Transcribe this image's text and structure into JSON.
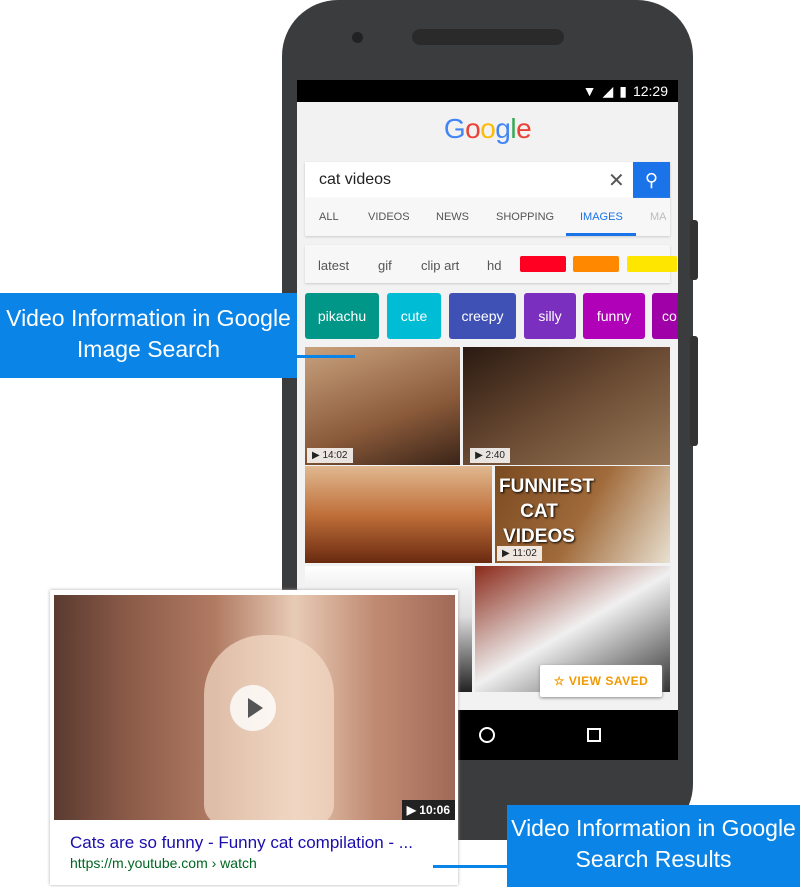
{
  "status_bar": {
    "time": "12:29",
    "icons": [
      "wifi-icon",
      "signal-icon",
      "battery-icon"
    ]
  },
  "logo": "Google",
  "logo_colors": [
    "#4285f4",
    "#ea4335",
    "#fbbc05",
    "#4285f4",
    "#34a853",
    "#ea4335"
  ],
  "search": {
    "query": "cat videos",
    "clear_icon": "close-icon",
    "submit_icon": "search-icon"
  },
  "tabs": [
    {
      "label": "ALL"
    },
    {
      "label": "VIDEOS"
    },
    {
      "label": "NEWS"
    },
    {
      "label": "SHOPPING"
    },
    {
      "label": "IMAGES",
      "active": true
    },
    {
      "label": "MA"
    }
  ],
  "filters": [
    "latest",
    "gif",
    "clip art",
    "hd"
  ],
  "color_filters": [
    "#ff0022",
    "#ff8800",
    "#ffe600"
  ],
  "chips": [
    {
      "label": "pikachu",
      "color": "#009688"
    },
    {
      "label": "cute",
      "color": "#00bcd4"
    },
    {
      "label": "creepy",
      "color": "#3f51b5"
    },
    {
      "label": "silly",
      "color": "#7b2fbe"
    },
    {
      "label": "funny",
      "color": "#b000b8"
    },
    {
      "label": "co",
      "color": "#a000a8"
    }
  ],
  "images": [
    {
      "duration": "14:02"
    },
    {
      "duration": "2:40"
    },
    {
      "duration": ""
    },
    {
      "duration": "11:02",
      "overlay_text": "FUNNIEST CAT VIDEOS"
    },
    {
      "duration": ""
    },
    {
      "duration": ""
    }
  ],
  "view_saved": "VIEW SAVED",
  "labels": {
    "image_search": "Video Information in Google Image Search",
    "search_results": "Video Information in Google Search Results"
  },
  "result": {
    "duration": "10:06",
    "title": "Cats are so funny - Funny cat compilation - ...",
    "url": "https://m.youtube.com › watch"
  }
}
